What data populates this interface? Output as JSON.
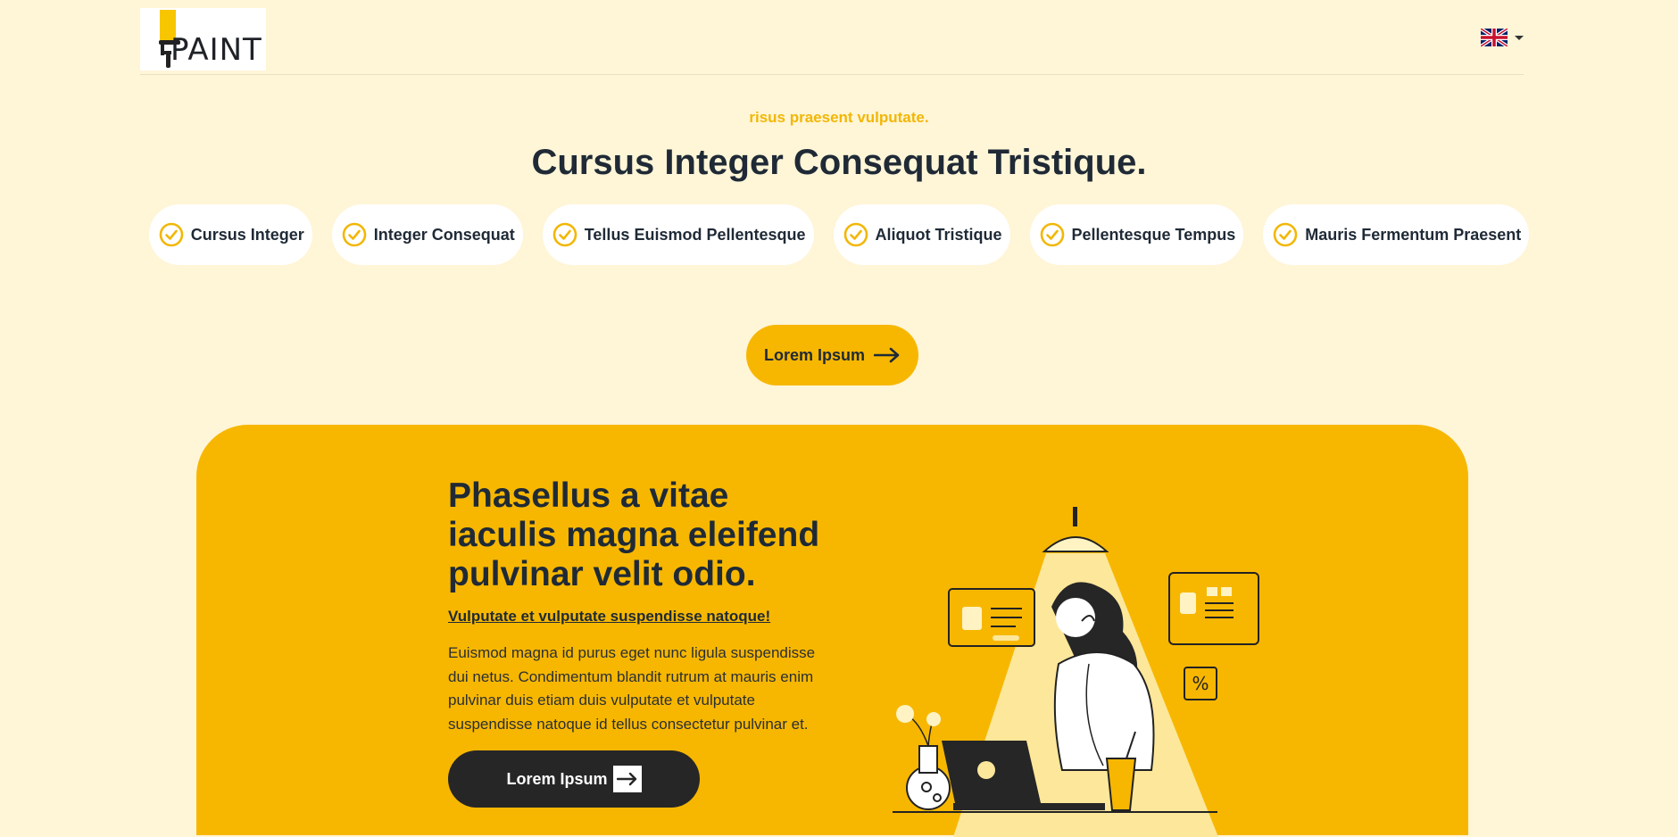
{
  "header": {
    "logo_text": "PAINT",
    "language_flag": "uk-flag-icon"
  },
  "hero": {
    "eyebrow": "risus praesent vulputate.",
    "title": "Cursus Integer Consequat Tristique.",
    "features": [
      "Cursus Integer",
      "Integer Consequat",
      "Tellus Euismod Pellentesque",
      "Aliquot Tristique",
      "Pellentesque Tempus",
      "Mauris Fermentum Praesent"
    ],
    "cta_label": "Lorem Ipsum"
  },
  "card": {
    "heading": "Phasellus a vitae iaculis magna eleifend pulvinar velit odio.",
    "link": "Vulputate et vulputate suspendisse natoque!",
    "text": "Euismod magna id purus eget nunc ligula suspendisse dui netus. Condimentum blandit rutrum at mauris enim pulvinar duis etiam duis vulputate et vulputate suspendisse natoque id tellus consectetur pulvinar et.",
    "button_label": "Lorem Ipsum"
  },
  "colors": {
    "background": "#fff5d7",
    "accent": "#f7b701",
    "dark": "#262626",
    "text": "#1f2a36"
  }
}
